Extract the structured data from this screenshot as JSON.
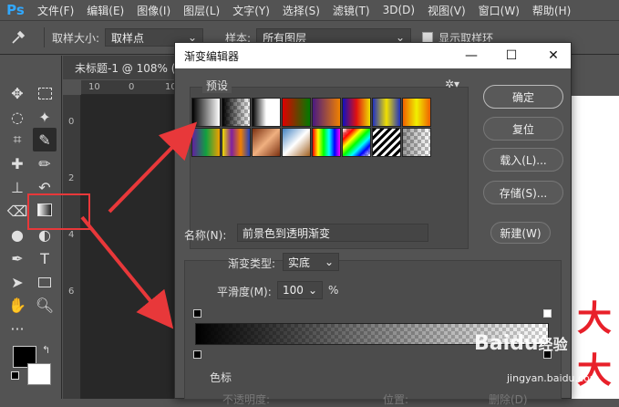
{
  "app": {
    "logo": "Ps"
  },
  "menu": [
    "文件(F)",
    "编辑(E)",
    "图像(I)",
    "图层(L)",
    "文字(Y)",
    "选择(S)",
    "滤镜(T)",
    "3D(D)",
    "视图(V)",
    "窗口(W)",
    "帮助(H)"
  ],
  "options": {
    "sample_size_label": "取样大小:",
    "sample_size_value": "取样点",
    "sample_label": "样本:",
    "sample_value": "所有图层",
    "show_ring_label": "显示取样环"
  },
  "document": {
    "tab_title": "未标题-1 @ 108% (",
    "ruler_h": [
      "10",
      "0",
      "10"
    ],
    "ruler_v": [
      "0",
      "2",
      "4",
      "6"
    ]
  },
  "dialog": {
    "title": "渐变编辑器",
    "presets_label": "预设",
    "buttons": {
      "ok": "确定",
      "reset": "复位",
      "load": "载入(L)...",
      "save": "存储(S)..."
    },
    "name_label": "名称(N):",
    "name_value": "前景色到透明渐变",
    "new_button": "新建(W)",
    "gradient_type_label": "渐变类型:",
    "gradient_type_value": "实底",
    "smoothness_label": "平滑度(M):",
    "smoothness_value": "100",
    "smoothness_unit": "%",
    "stops_label": "色标",
    "opacity_label": "不透明度:",
    "location_label": "位置:",
    "delete_label": "删除(D)"
  },
  "presets": [
    {
      "type": "fg-bg",
      "colors": [
        "#000000",
        "#ffffff"
      ]
    },
    {
      "type": "fg-transparent",
      "colors": [
        "#000000"
      ]
    },
    {
      "type": "black-white",
      "colors": [
        "#000000",
        "#ffffff"
      ]
    },
    {
      "type": "red-green",
      "colors": [
        "#e00000",
        "#007a00"
      ]
    },
    {
      "type": "violet-orange",
      "colors": [
        "#4a1a80",
        "#f08000"
      ]
    },
    {
      "type": "blue-red-yellow",
      "colors": [
        "#1010c0",
        "#e01010",
        "#f0e000"
      ]
    },
    {
      "type": "blue-yellow-blue",
      "colors": [
        "#2030c0",
        "#f0e000",
        "#2030c0"
      ]
    },
    {
      "type": "orange-yellow-orange",
      "colors": [
        "#f06000",
        "#f0f000",
        "#f06000"
      ]
    },
    {
      "type": "violet-green-orange",
      "colors": [
        "#6020a0",
        "#10a040",
        "#f0a000"
      ]
    },
    {
      "type": "yellow-violet-orange-blue",
      "colors": [
        "#f0e000",
        "#8020a0",
        "#f08000",
        "#2040c0"
      ]
    },
    {
      "type": "copper",
      "colors": [
        "#7a3010",
        "#f0b080",
        "#7a3010"
      ]
    },
    {
      "type": "chrome",
      "colors": [
        "#4080c0",
        "#ffffff",
        "#a06020"
      ]
    },
    {
      "type": "spectrum",
      "colors": [
        "#ff0000",
        "#ffff00",
        "#00ff00",
        "#00ffff",
        "#0000ff",
        "#ff00ff"
      ]
    },
    {
      "type": "transparent-rainbow",
      "colors": [
        "#ff0000",
        "#ffff00",
        "#00ff00",
        "#00ffff",
        "#0000ff"
      ]
    },
    {
      "type": "transparent-stripes",
      "colors": [
        "#000000",
        "#ffffff"
      ]
    },
    {
      "type": "neutral-density",
      "colors": [
        "#888888"
      ]
    }
  ],
  "watermark": {
    "brand": "Baidu",
    "suffix": "经验",
    "url": "jingyan.baidu.com"
  },
  "colors": {
    "accent": "#31a8ff",
    "annotation": "#e8383a"
  }
}
